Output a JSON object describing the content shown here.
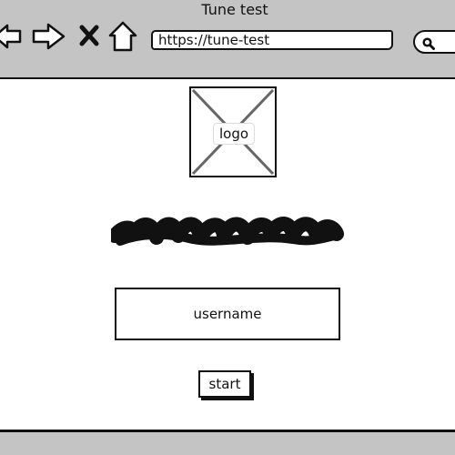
{
  "window": {
    "title": "Tune test"
  },
  "toolbar": {
    "back_icon": "arrow-left-icon",
    "forward_icon": "arrow-right-icon",
    "stop_icon": "close-icon",
    "home_icon": "home-icon",
    "search_icon": "search-icon"
  },
  "address_bar": {
    "url": "https://tune-test"
  },
  "page": {
    "logo": {
      "label": "logo",
      "icon": "image-placeholder-icon"
    },
    "headline": {
      "icon": "scribble-text-placeholder"
    },
    "username_field": {
      "placeholder": "username",
      "value": ""
    },
    "start_button": {
      "label": "start"
    }
  },
  "colors": {
    "chrome_background": "#c4c4c4",
    "page_background": "#ffffff",
    "ink": "#111111",
    "logo_cross": "#666666"
  }
}
